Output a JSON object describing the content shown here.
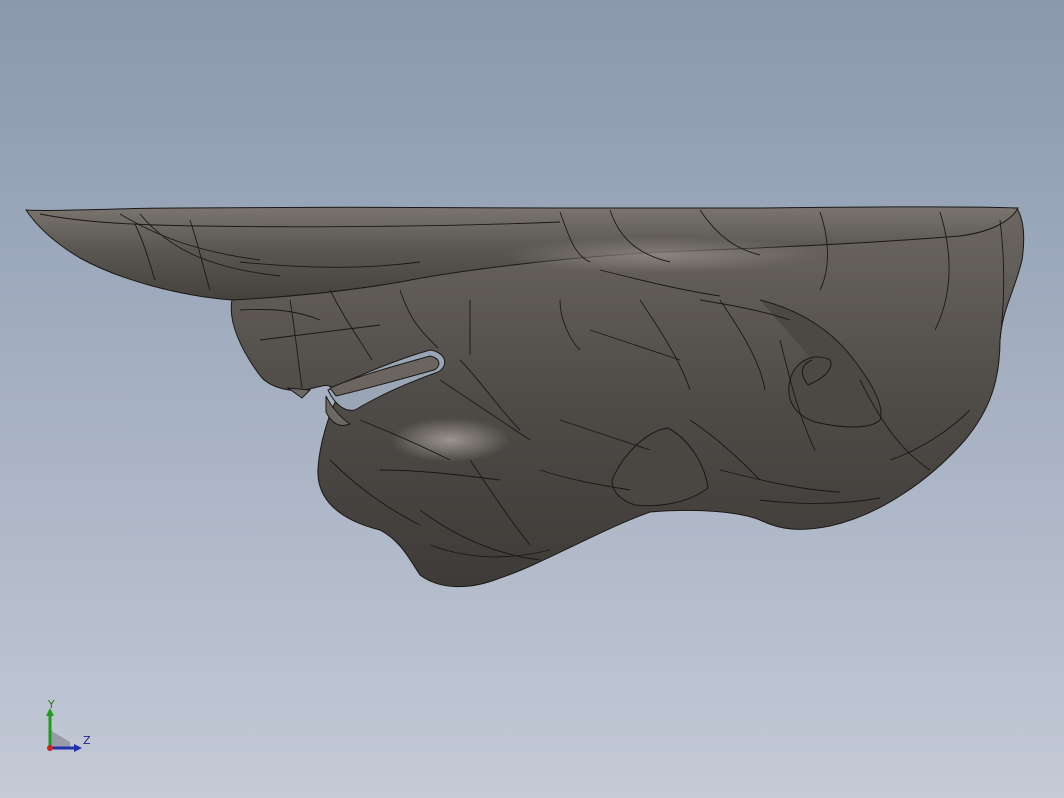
{
  "viewport": {
    "background_top": "#8a99ae",
    "background_bottom": "#c4cad6"
  },
  "model": {
    "name": "bull-head-surface-model",
    "surface_color": "#57534f",
    "edge_color": "#1a1816"
  },
  "triad": {
    "y_label": "Y",
    "z_label": "Z",
    "y_color": "#1e9a1e",
    "z_color": "#2233aa",
    "origin_color": "#cc2222"
  }
}
